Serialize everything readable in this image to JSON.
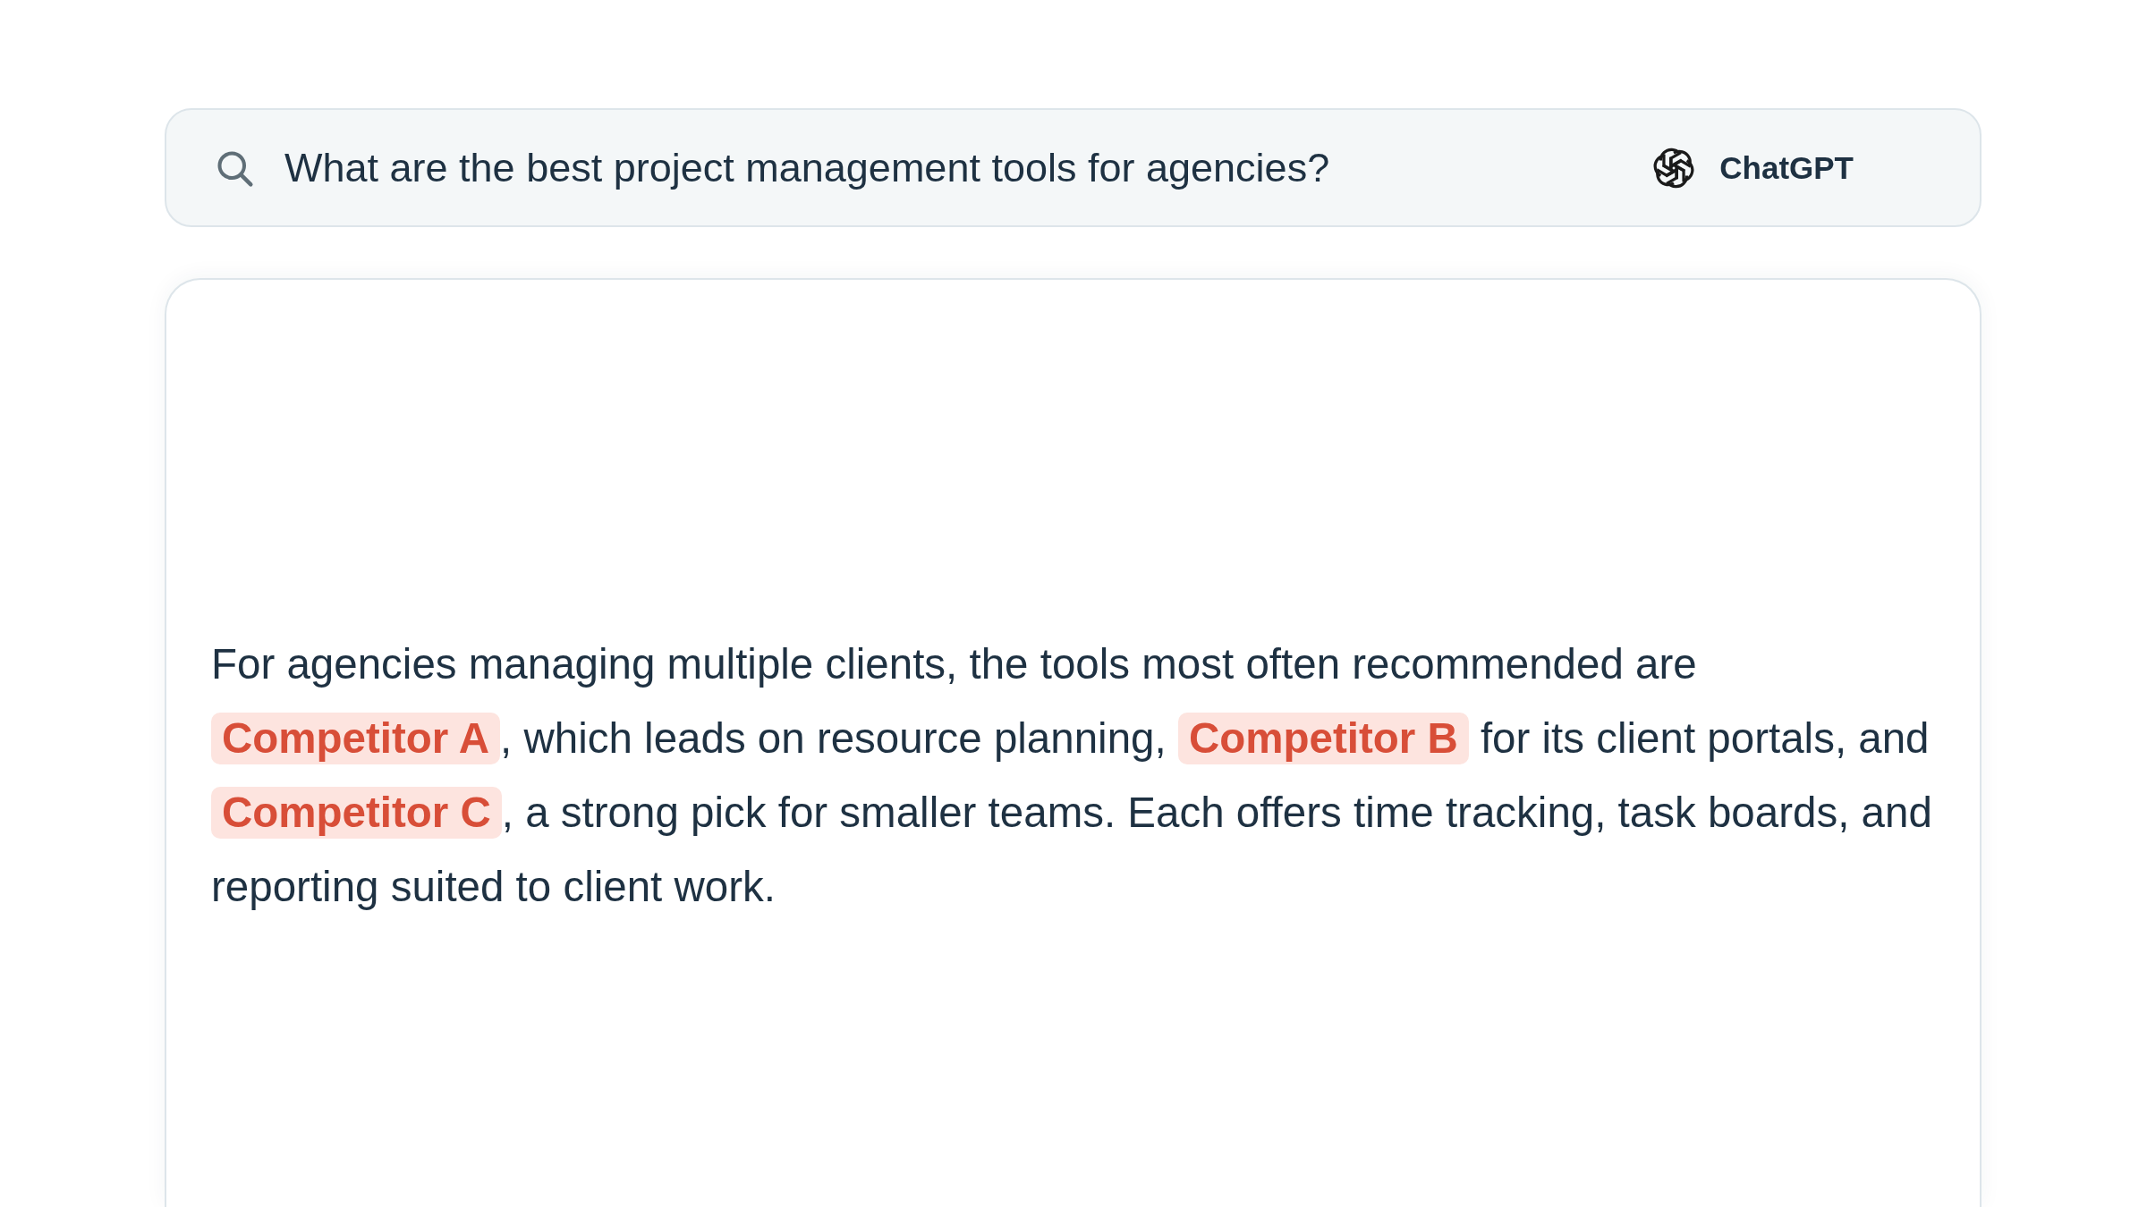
{
  "search_bar": {
    "query": "What are the best project management tools for agencies?",
    "engine": {
      "label": "ChatGPT"
    }
  },
  "answer": {
    "segments": [
      {
        "kind": "text",
        "text": "For agencies managing multiple clients, the tools most often recommended are "
      },
      {
        "kind": "mention",
        "text": "Competitor A"
      },
      {
        "kind": "text",
        "text": ", which leads on resource planning, "
      },
      {
        "kind": "mention",
        "text": "Competitor B"
      },
      {
        "kind": "text",
        "text": " for its client portals, and "
      },
      {
        "kind": "mention",
        "text": "Competitor C"
      },
      {
        "kind": "text",
        "text": ", a strong pick for smaller teams. Each offers time tracking, task boards, and reporting suited to client work."
      }
    ]
  }
}
